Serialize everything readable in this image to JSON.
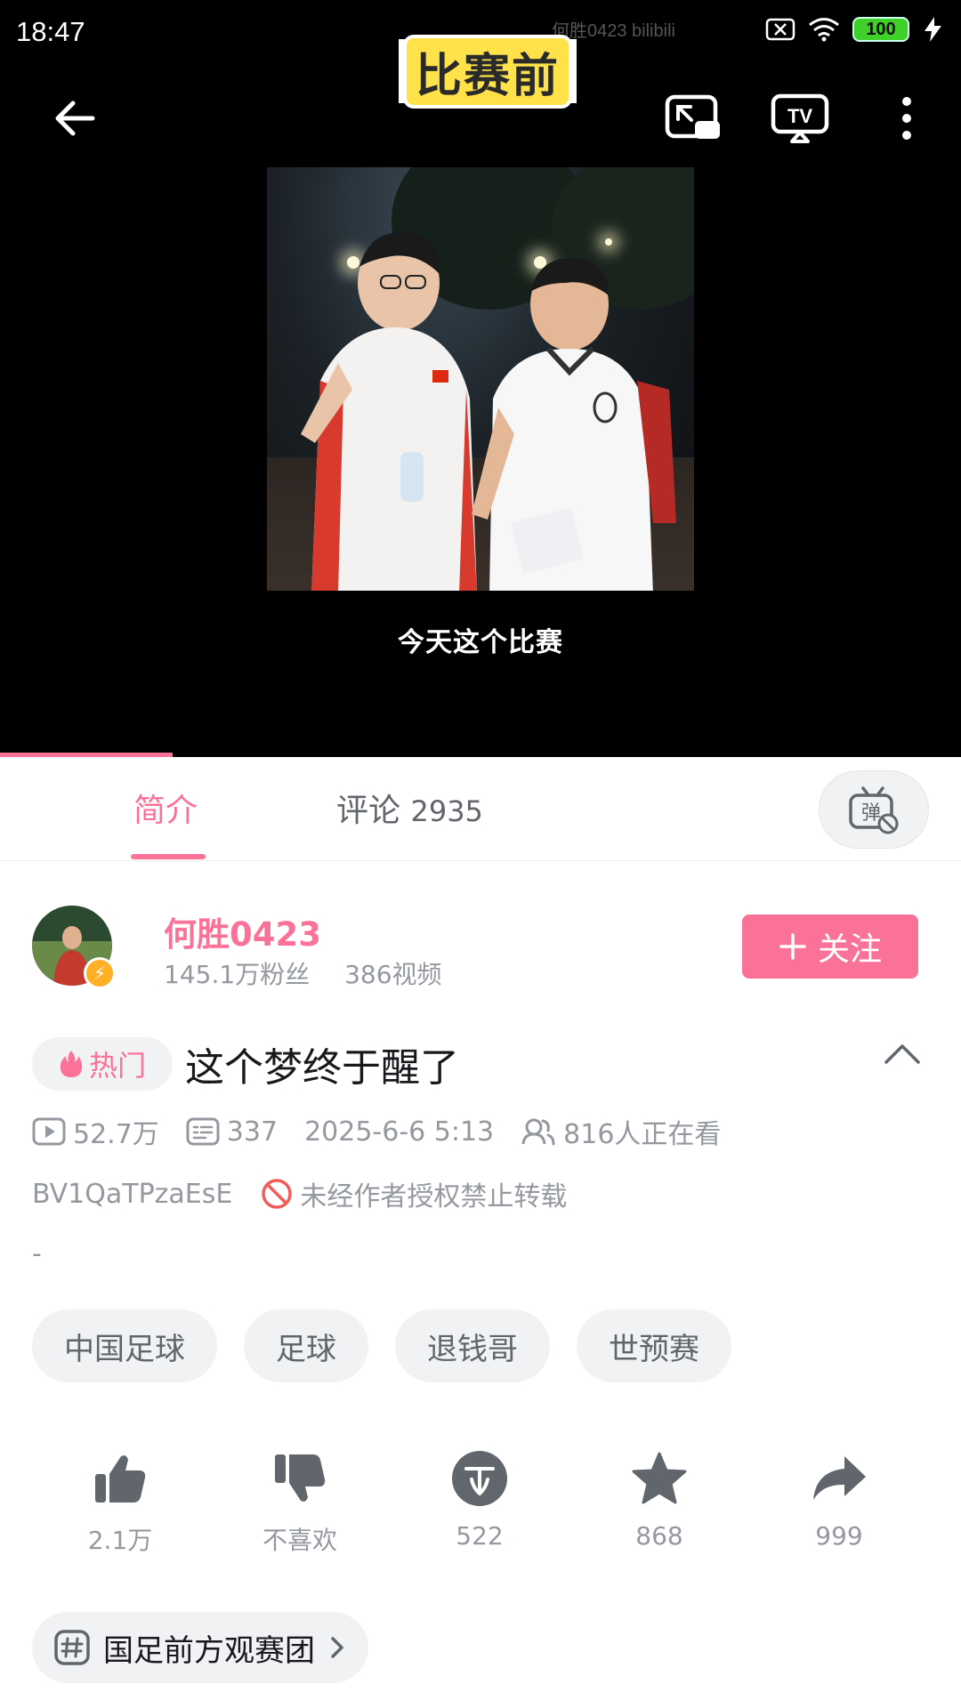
{
  "status_bar": {
    "time": "18:47",
    "battery": "100",
    "icons": [
      "sim-off-icon",
      "wifi-icon",
      "battery-icon",
      "charging-icon"
    ]
  },
  "video": {
    "watermark": "何胜0423 bilibili",
    "top_caption": "比赛前",
    "subtitle": "今天这个比赛",
    "progress": 0.18,
    "accent_color": "#fb7299"
  },
  "tabs": [
    {
      "label": "简介",
      "active": true
    },
    {
      "label": "评论",
      "count": "2935",
      "active": false
    }
  ],
  "uploader": {
    "name": "何胜0423",
    "fans": "145.1万粉丝",
    "videos": "386视频",
    "follow_label": "关注"
  },
  "title": {
    "badge": "热门",
    "text": "这个梦终于醒了"
  },
  "meta": {
    "views": "52.7万",
    "danmaku": "337",
    "date": "2025-6-6 5:13",
    "watching": "816人正在看",
    "bvid": "BV1QaTPzaEsE",
    "notice": "未经作者授权禁止转载",
    "description": "-"
  },
  "tags": [
    "中国足球",
    "足球",
    "退钱哥",
    "世预赛"
  ],
  "actions": [
    {
      "icon": "like-icon",
      "label": "2.1万"
    },
    {
      "icon": "dislike-icon",
      "label": "不喜欢"
    },
    {
      "icon": "coin-icon",
      "label": "522"
    },
    {
      "icon": "favorite-icon",
      "label": "868"
    },
    {
      "icon": "share-icon",
      "label": "999"
    }
  ],
  "topic": {
    "label": "国足前方观赛团"
  }
}
